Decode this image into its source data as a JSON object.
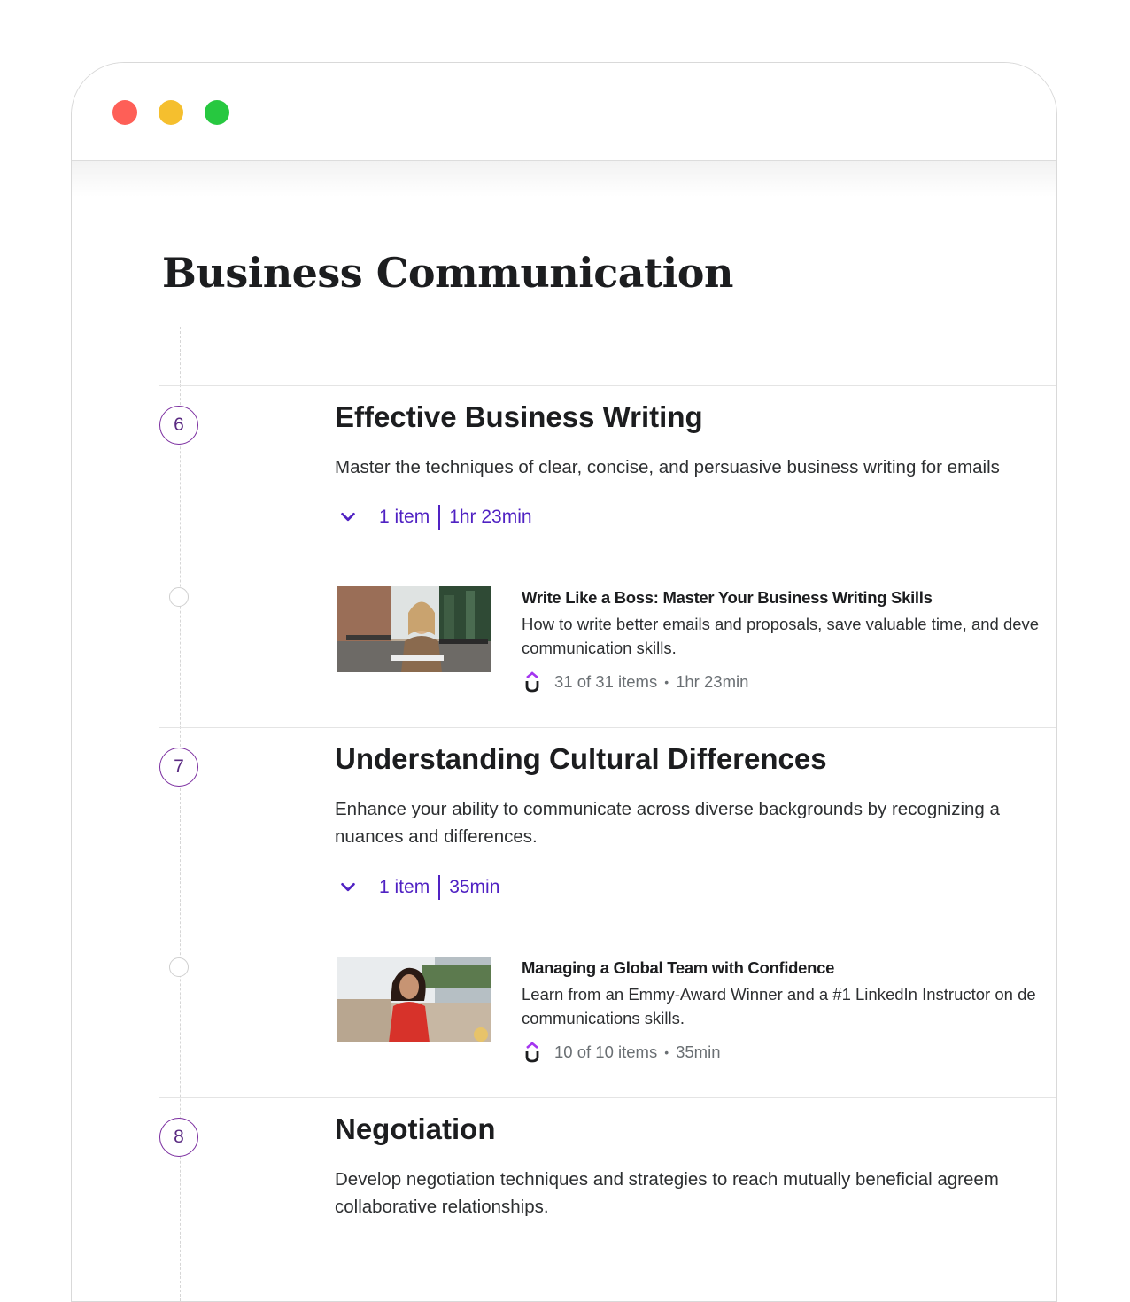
{
  "window": {
    "controls": [
      "close-dot",
      "minimize-dot",
      "maximize-dot"
    ]
  },
  "page": {
    "title": "Business Communication"
  },
  "colors": {
    "accent_purple": "#5022c3",
    "step_circle": "#7b2ea0",
    "close": "#fe5f57",
    "minimize": "#f5bf2e",
    "maximize": "#27c840"
  },
  "sections": [
    {
      "number": "6",
      "title": "Effective Business Writing",
      "description": "Master the techniques of clear, concise, and persuasive business writing for emails",
      "items_label": "1 item",
      "duration": "1hr 23min",
      "course": {
        "title": "Write Like a Boss: Master Your Business Writing Skills",
        "description": "How to write better emails and proposals, save valuable time, and deve communication skills.",
        "progress": "31 of 31 items",
        "duration": "1hr 23min",
        "provider_icon": "udemy-u-icon"
      }
    },
    {
      "number": "7",
      "title": "Understanding Cultural Differences",
      "description": "Enhance your ability to communicate across diverse backgrounds by recognizing a nuances and differences.",
      "items_label": "1 item",
      "duration": "35min",
      "course": {
        "title": "Managing a Global Team with Confidence",
        "description": "Learn from an Emmy-Award Winner and a #1 LinkedIn Instructor on de communications skills.",
        "progress": "10 of 10 items",
        "duration": "35min",
        "provider_icon": "udemy-u-icon"
      }
    },
    {
      "number": "8",
      "title": "Negotiation",
      "description": "Develop negotiation techniques and strategies to reach mutually beneficial agreem collaborative relationships."
    }
  ]
}
